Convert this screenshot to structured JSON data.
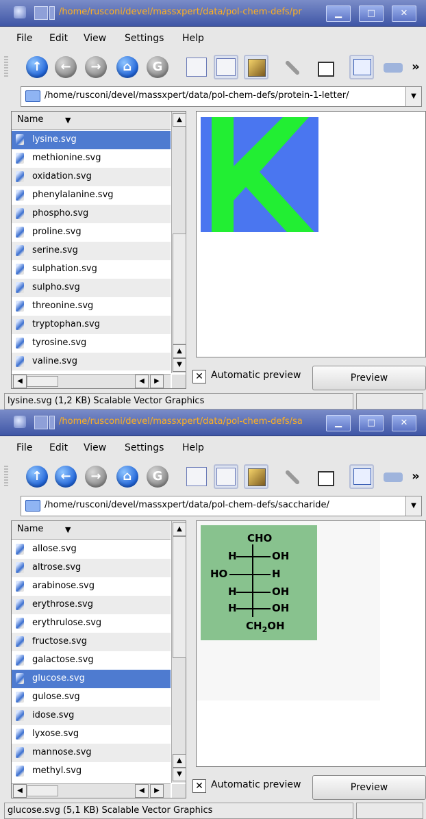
{
  "windows": [
    {
      "title": "/home/rusconi/devel/massxpert/data/pol-chem-defs/pr",
      "menu": [
        "File",
        "Edit",
        "View",
        "Settings",
        "Help"
      ],
      "location": "/home/rusconi/devel/massxpert/data/pol-chem-defs/protein-1-letter/",
      "column_header": "Name",
      "files": [
        "lysine.svg",
        "methionine.svg",
        "oxidation.svg",
        "phenylalanine.svg",
        "phospho.svg",
        "proline.svg",
        "serine.svg",
        "sulphation.svg",
        "sulpho.svg",
        "threonine.svg",
        "tryptophan.svg",
        "tyrosine.svg",
        "valine.svg"
      ],
      "selected_index": 0,
      "preview_letter": "K",
      "auto_preview_label": "Automatic preview",
      "preview_button": "Preview",
      "status": "lysine.svg (1,2 KB)  Scalable Vector Graphics"
    },
    {
      "title": "/home/rusconi/devel/massxpert/data/pol-chem-defs/sa",
      "menu": [
        "File",
        "Edit",
        "View",
        "Settings",
        "Help"
      ],
      "location": "/home/rusconi/devel/massxpert/data/pol-chem-defs/saccharide/",
      "column_header": "Name",
      "files": [
        "allose.svg",
        "altrose.svg",
        "arabinose.svg",
        "erythrose.svg",
        "erythrulose.svg",
        "fructose.svg",
        "galactose.svg",
        "glucose.svg",
        "gulose.svg",
        "idose.svg",
        "lyxose.svg",
        "mannose.svg",
        "methyl.svg"
      ],
      "selected_index": 7,
      "structure": {
        "top": "CHO",
        "rows": [
          [
            "H",
            "OH"
          ],
          [
            "HO",
            "H"
          ],
          [
            "H",
            "OH"
          ],
          [
            "H",
            "OH"
          ]
        ],
        "bottom": "CH",
        "bottom_sub": "2",
        "bottom_tail": "OH"
      },
      "auto_preview_label": "Automatic preview",
      "preview_button": "Preview",
      "status": "glucose.svg (5,1 KB)  Scalable Vector Graphics"
    }
  ],
  "colors": {
    "selection": "#4e7bd0",
    "title_text": "#ffb020",
    "preview_k_bg": "#4a76f0",
    "preview_k_letter": "#22ee33",
    "preview_sugar_bg": "#88c28e"
  },
  "toolbar_icons": [
    "up-arrow-icon",
    "back-arrow-icon",
    "forward-arrow-icon",
    "home-icon",
    "reload-icon",
    "icon-view-icon",
    "detail-view-icon",
    "preview-toggle-icon",
    "wrench-icon",
    "stack-icon",
    "new-window-icon",
    "print-icon",
    "more-icon"
  ]
}
